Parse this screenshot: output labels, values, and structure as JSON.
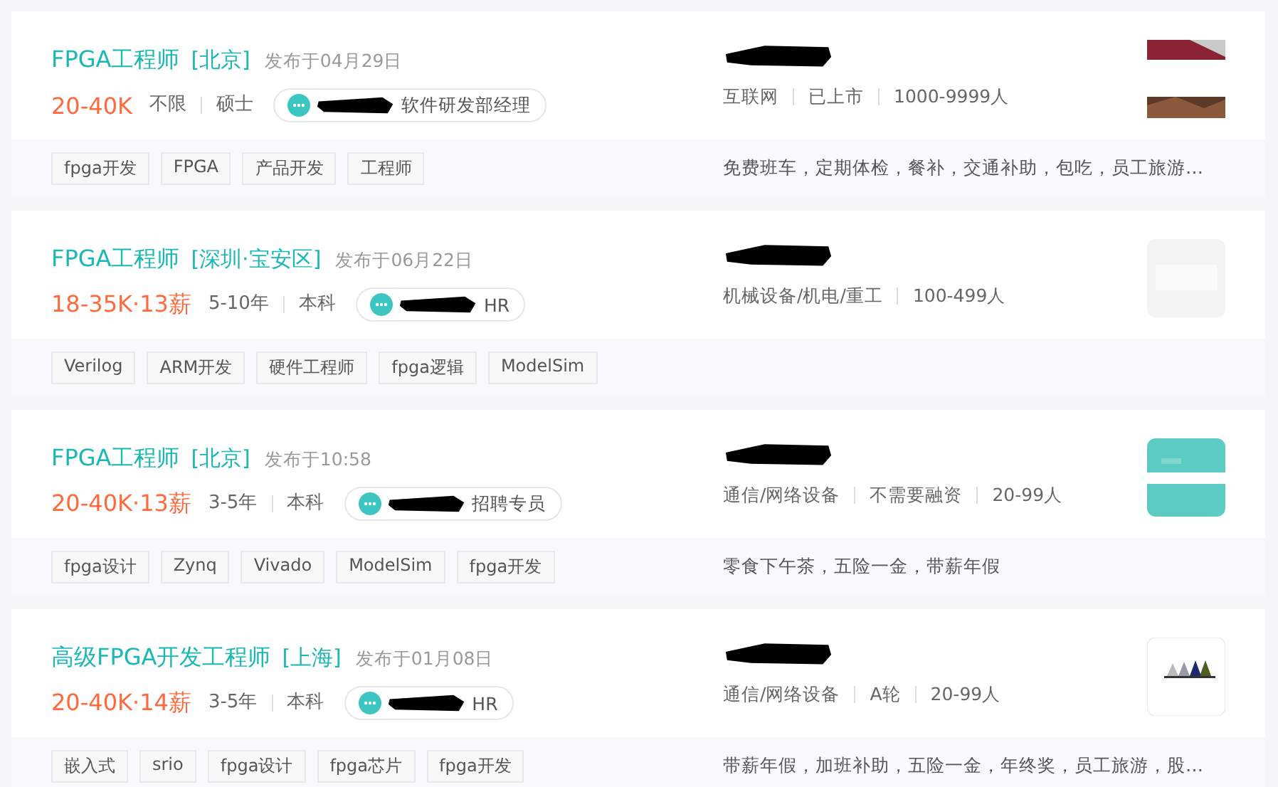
{
  "jobs": [
    {
      "title": "FPGA工程师",
      "location": "[北京]",
      "posted": "发布于04月29日",
      "salary": "20-40K",
      "requirements": [
        "不限",
        "硕士"
      ],
      "recruiter_role": "软件研发部经理",
      "company_tags": [
        "互联网",
        "已上市",
        "1000-9999人"
      ],
      "tags": [
        "fpga开发",
        "FPGA",
        "产品开发",
        "工程师"
      ],
      "benefits": "免费班车，定期体检，餐补，交通补助，包吃，员工旅游…",
      "logo": {
        "kind": "picture"
      }
    },
    {
      "title": "FPGA工程师",
      "location": "[深圳·宝安区]",
      "posted": "发布于06月22日",
      "salary": "18-35K·13薪",
      "requirements": [
        "5-10年",
        "本科"
      ],
      "recruiter_role": "HR",
      "company_tags": [
        "机械设备/机电/重工",
        "100-499人"
      ],
      "tags": [
        "Verilog",
        "ARM开发",
        "硬件工程师",
        "fpga逻辑",
        "ModelSim"
      ],
      "logo": {
        "kind": "picture"
      }
    },
    {
      "title": "FPGA工程师",
      "location": "[北京]",
      "posted": "发布于10:58",
      "salary": "20-40K·13薪",
      "requirements": [
        "3-5年",
        "本科"
      ],
      "recruiter_role": "招聘专员",
      "company_tags": [
        "通信/网络设备",
        "不需要融资",
        "20-99人"
      ],
      "tags": [
        "fpga设计",
        "Zynq",
        "Vivado",
        "ModelSim",
        "fpga开发"
      ],
      "benefits": "零食下午茶，五险一金，带薪年假",
      "logo": {
        "kind": "picture"
      }
    },
    {
      "title": "高级FPGA开发工程师",
      "location": "[上海]",
      "posted": "发布于01月08日",
      "salary": "20-40K·14薪",
      "requirements": [
        "3-5年",
        "本科"
      ],
      "recruiter_role": "HR",
      "company_tags": [
        "通信/网络设备",
        "A轮",
        "20-99人"
      ],
      "tags": [
        "嵌入式",
        "srio",
        "fpga设计",
        "fpga芯片",
        "fpga开发"
      ],
      "benefits": "带薪年假，加班补助，五险一金，年终奖，员工旅游，股…",
      "logo": {
        "kind": "picture"
      }
    }
  ]
}
